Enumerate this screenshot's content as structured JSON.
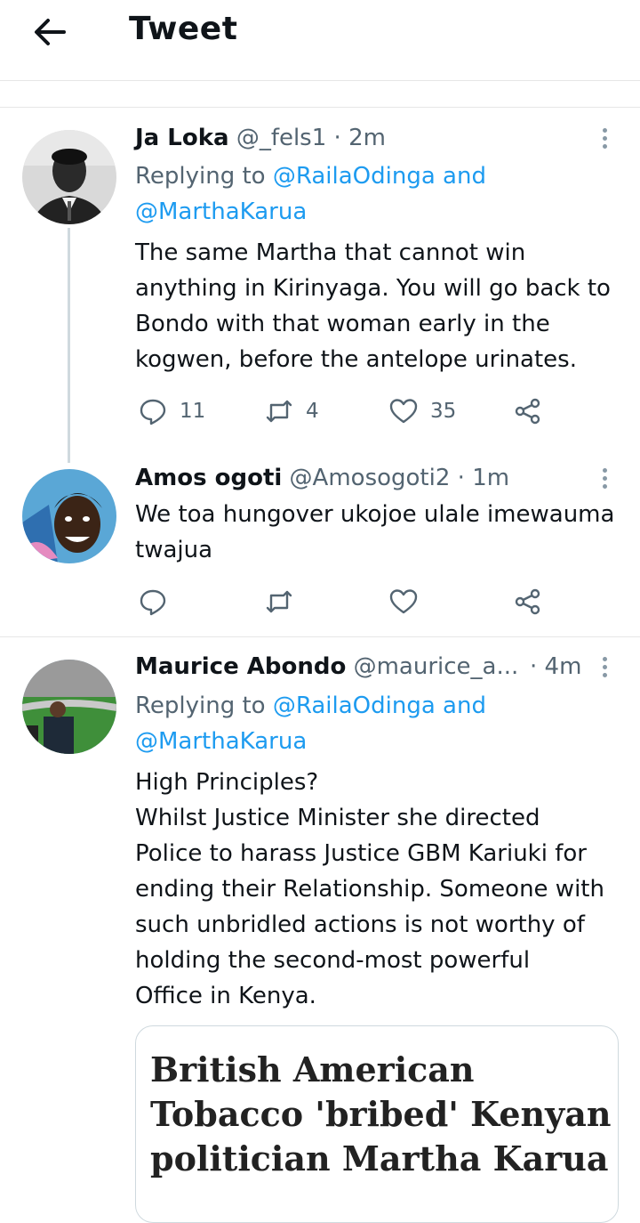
{
  "header": {
    "title": "Tweet"
  },
  "tweets": [
    {
      "name": "Ja Loka",
      "handle": "@_fels1",
      "time": "2m",
      "replying_prefix": "Replying to ",
      "replying_mention1": "@RailaOdinga",
      "replying_and": " and",
      "replying_mention2": "@MarthaKarua",
      "text": "The same Martha that cannot win\nanything in Kirinyaga. You will go back to\nBondo with that woman early in the\nkogwen, before the antelope urinates.",
      "replies": "11",
      "retweets": "4",
      "likes": "35"
    },
    {
      "name": "Amos ogoti",
      "handle": "@Amosogoti2",
      "time": "1m",
      "text": "We toa hungover ukojoe ulale imewauma\ntwajua"
    },
    {
      "name": "Maurice Abondo",
      "handle": "@maurice_a...",
      "time": "4m",
      "replying_prefix": "Replying to ",
      "replying_mention1": "@RailaOdinga",
      "replying_and": " and",
      "replying_mention2": "@MarthaKarua",
      "text": "High Principles?\nWhilst Justice Minister she directed\nPolice to harass Justice GBM Kariuki  for\nending their Relationship. Someone with\nsuch unbridled actions is not worthy of\nholding the second-most powerful\nOffice in Kenya.",
      "card_headline": "British American\nTobacco 'bribed' Kenyan\npolitician Martha Karua"
    }
  ],
  "dot": "·",
  "colors": {
    "accent": "#1d9bf0",
    "muted": "#536471",
    "divider": "#e6e6e6"
  },
  "icons": [
    "back-arrow-icon",
    "more-vertical-icon",
    "reply-icon",
    "retweet-icon",
    "like-icon",
    "share-icon"
  ]
}
